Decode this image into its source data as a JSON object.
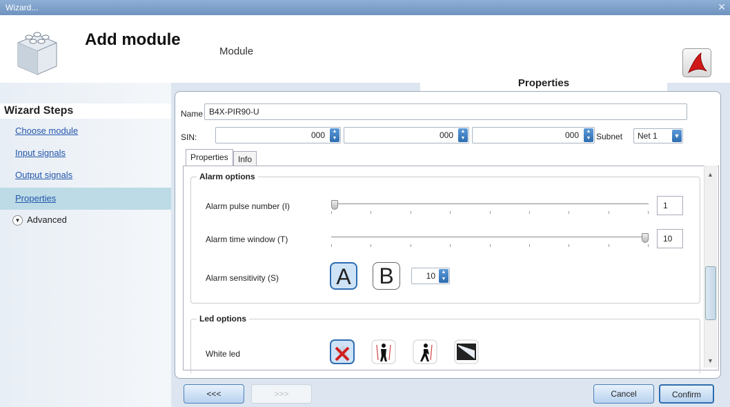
{
  "window": {
    "title": "Wizard...",
    "close": "✕"
  },
  "header": {
    "title": "Add module",
    "subtitle": "Module",
    "section_tab": "Properties"
  },
  "sidebar": {
    "title": "Wizard Steps",
    "items": [
      {
        "label": "Choose module"
      },
      {
        "label": "Input signals"
      },
      {
        "label": "Output signals"
      },
      {
        "label": "Properties"
      }
    ],
    "advanced": "Advanced"
  },
  "form": {
    "name_label": "Name",
    "name_value": "B4X-PIR90-U",
    "sin_label": "SIN:",
    "sin1": "000",
    "sin2": "000",
    "sin3": "000",
    "subnet_label": "Subnet",
    "subnet_value": "Net 1"
  },
  "tabs": [
    {
      "label": "Properties"
    },
    {
      "label": "Info"
    }
  ],
  "alarm": {
    "title": "Alarm options",
    "pulse_label": "Alarm pulse number (I)",
    "pulse_value": "1",
    "pulse_level": 0.0,
    "window_label": "Alarm time window (T)",
    "window_value": "10",
    "window_level": 1.0,
    "sensitivity_label": "Alarm sensitivity (S)",
    "mode_a": "A",
    "mode_b": "B",
    "sensitivity_value": "10"
  },
  "led": {
    "title": "Led options",
    "white_label": "White led"
  },
  "buttons": {
    "back": "<<<",
    "next": ">>>",
    "cancel": "Cancel",
    "confirm": "Confirm"
  },
  "colors": {
    "accent": "#2d6cb0",
    "selected_step": "#bcdbe6"
  }
}
